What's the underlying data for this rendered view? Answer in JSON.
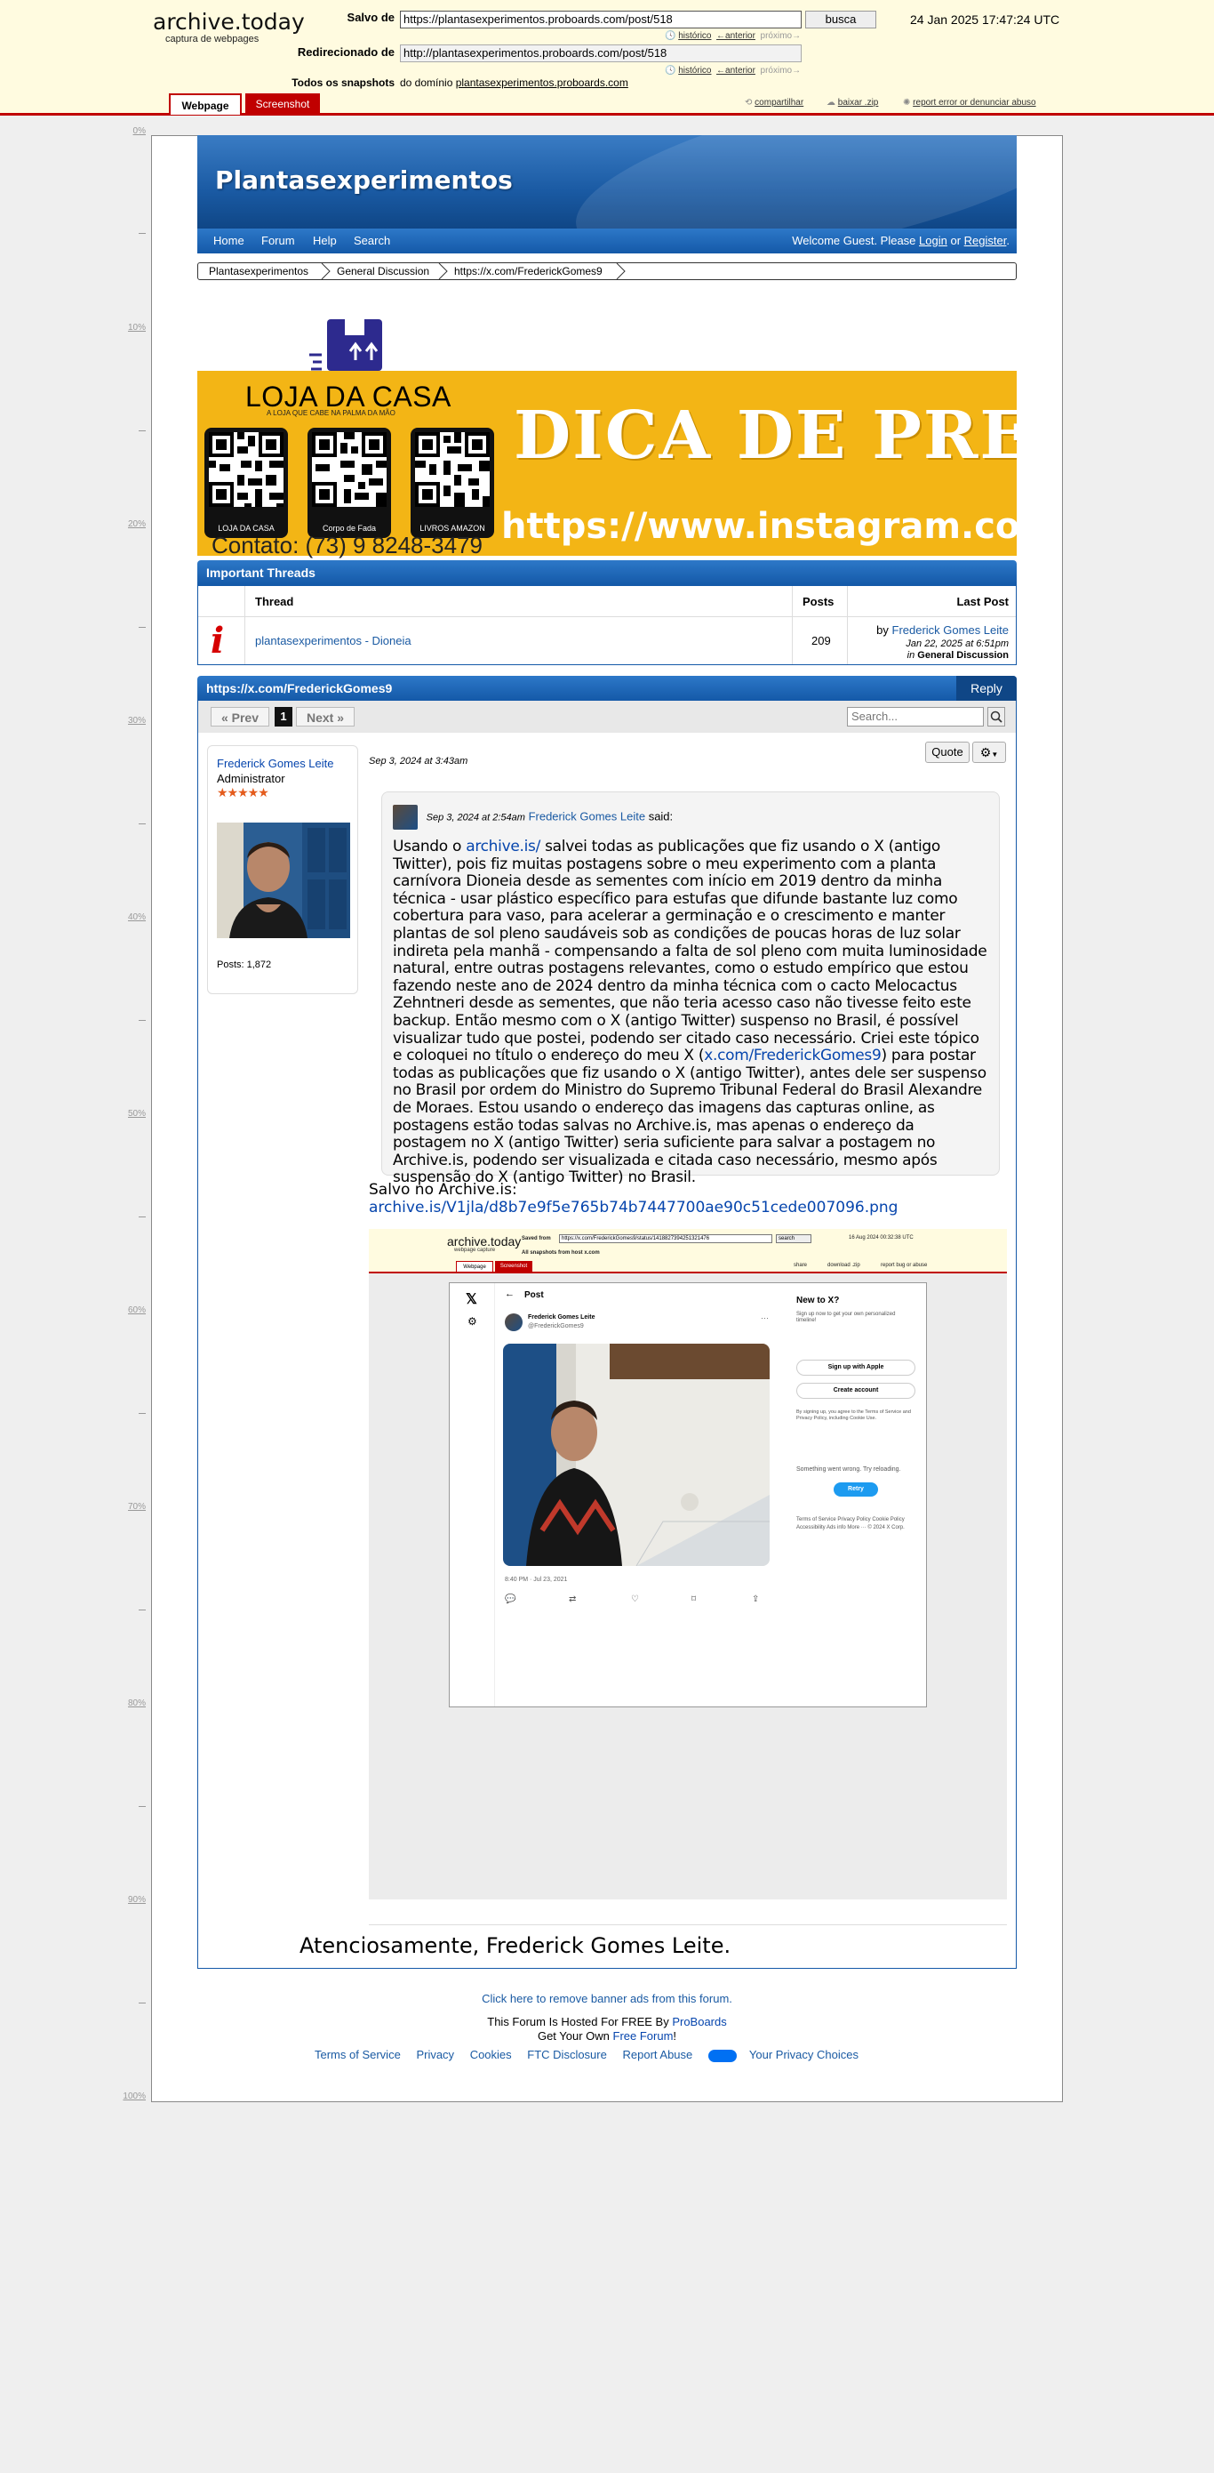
{
  "archive": {
    "logo": "archive.today",
    "subtitle": "captura de webpages",
    "saved_from_label": "Salvo de",
    "saved_from_url": "https://plantasexperimentos.proboards.com/post/518",
    "search_button": "busca",
    "redirected_label": "Redirecionado de",
    "redirected_url": "http://plantasexperimentos.proboards.com/post/518",
    "history_link": "histórico",
    "prev_link": "←anterior",
    "next_link": "próximo→",
    "snapshots_label": "Todos os snapshots",
    "snapshots_prefix": "do domínio",
    "snapshots_domain": "plantasexperimentos.proboards.com",
    "date": "24 Jan 2025 17:47:24 UTC",
    "tab_webpage": "Webpage",
    "tab_screenshot": "Screenshot",
    "share": "compartilhar",
    "download": "baixar .zip",
    "report": "report error or denunciar abuso",
    "ruler": [
      "0%",
      "10%",
      "20%",
      "30%",
      "40%",
      "50%",
      "60%",
      "70%",
      "80%",
      "90%",
      "100%"
    ]
  },
  "forum": {
    "title": "Plantasexperimentos",
    "nav": [
      "Home",
      "Forum",
      "Help",
      "Search"
    ],
    "welcome_prefix": "Welcome Guest. Please",
    "login": "Login",
    "or": "or",
    "register": "Register",
    "welcome_suffix": ".",
    "breadcrumb": [
      "Plantasexperimentos",
      "General Discussion",
      "https://x.com/FrederickGomes9"
    ]
  },
  "ad": {
    "shop_name": "LOJA DA CASA",
    "shop_tagline": "A LOJA QUE CABE NA PALMA DA MÃO",
    "headline": "DICA DE PRESENTE",
    "url": "https://www.instagram.com/lo",
    "qr_labels": [
      "LOJA DA CASA",
      "Corpo de Fada",
      "LIVROS AMAZON"
    ],
    "contact": "Contato: (73) 9 8248-3479"
  },
  "important_threads": {
    "header": "Important Threads",
    "col_thread": "Thread",
    "col_posts": "Posts",
    "col_last_post": "Last Post",
    "row": {
      "title": "plantasexperimentos - Dioneia",
      "posts": "209",
      "by_prefix": "by",
      "author": "Frederick Gomes Leite",
      "date": "Jan 22, 2025 at 6:51pm",
      "in_prefix": "in",
      "board": "General Discussion"
    }
  },
  "thread": {
    "title": "https://x.com/FrederickGomes9",
    "reply": "Reply",
    "prev": "« Prev",
    "page": "1",
    "next": "Next »",
    "search_placeholder": "Search...",
    "user": {
      "name": "Frederick Gomes Leite",
      "role": "Administrator",
      "stars": "★★★★★",
      "posts": "Posts: 1,872"
    },
    "post": {
      "date": "Sep 3, 2024 at 3:43am",
      "quote_button": "Quote",
      "quote_date": "Sep 3, 2024 at 2:54am",
      "quote_author": "Frederick Gomes Leite",
      "quote_said": "said:",
      "body_part1": "Usando o ",
      "body_link1": "archive.is/",
      "body_part2": " salvei todas as publicações que fiz usando o X (antigo Twitter), pois fiz muitas postagens sobre o meu experimento com a planta carnívora Dioneia desde as sementes com início em 2019 dentro da minha técnica - usar plástico específico para estufas que difunde bastante luz como cobertura para vaso, para acelerar a germinação e o crescimento e manter plantas de sol pleno saudáveis sob as condições de poucas horas de luz solar indireta pela manhã - compensando a falta de sol pleno com muita luminosidade natural, entre outras postagens relevantes, como o estudo empírico que estou fazendo neste ano de 2024 dentro da minha técnica com o cacto Melocactus Zehntneri desde as sementes, que não teria acesso caso não tivesse feito este backup. Então mesmo com o X (antigo Twitter) suspenso no Brasil, é possível visualizar tudo que postei, podendo ser citado caso necessário. Criei este tópico e coloquei no título o endereço do meu X (",
      "body_link2": "x.com/FrederickGomes9",
      "body_part3": ") para postar todas as publicações que fiz usando o X (antigo Twitter), antes dele ser suspenso no Brasil por ordem do Ministro do Supremo Tribunal Federal do Brasil Alexandre de Moraes. Estou usando o endereço das imagens das capturas online, as postagens estão todas salvas no Archive.is, mas apenas o endereço da postagem no X (antigo Twitter) seria suficiente para salvar a postagem no Archive.is, podendo ser visualizada e citada caso necessário, mesmo após suspensão do X (antigo Twitter) no Brasil.",
      "saved_label": "Salvo no Archive.is:",
      "saved_link": "archive.is/V1jla/d8b7e9f5e765b74b7447700ae90c51cede007096.png",
      "signoff": "Atenciosamente, Frederick Gomes Leite."
    },
    "embedded": {
      "logo": "archive.today",
      "logo_sub": "webpage capture",
      "saved_from": "Saved from",
      "saved_url": "https://x.com/FrederickGomes9/status/1418827394251321476",
      "search": "search",
      "date": "16 Aug 2024 00:32:38 UTC",
      "snapshots": "All snapshots from host x.com",
      "tab_webpage": "Webpage",
      "tab_screenshot": "Screenshot",
      "share": "share",
      "download": "download .zip",
      "report": "report bug or abuse",
      "x_logo": "𝕏",
      "post_title": "Post",
      "user_name": "Frederick Gomes Leite",
      "user_handle": "@FrederickGomes9",
      "time": "8:40 PM · Jul 23, 2021",
      "new_to_x": "New to X?",
      "new_sub": "Sign up now to get your own personalized timeline!",
      "apple": "Sign up with Apple",
      "create": "Create account",
      "terms": "By signing up, you agree to the Terms of Service and Privacy Policy, including Cookie Use.",
      "wrong": "Something went wrong. Try reloading.",
      "retry": "Retry",
      "footer": "Terms of Service   Privacy Policy   Cookie Policy   Accessibility   Ads info   More ···   © 2024 X Corp."
    }
  },
  "footer": {
    "remove_ads": "Click here to remove banner ads from this forum.",
    "hosted_prefix": "This Forum Is Hosted For FREE By ",
    "hosted_link": "ProBoards",
    "own_prefix": "Get Your Own ",
    "own_link": "Free Forum",
    "own_suffix": "!",
    "links": [
      "Terms of Service",
      "Privacy",
      "Cookies",
      "FTC Disclosure",
      "Report Abuse"
    ],
    "privacy_choices": "Your Privacy Choices"
  }
}
